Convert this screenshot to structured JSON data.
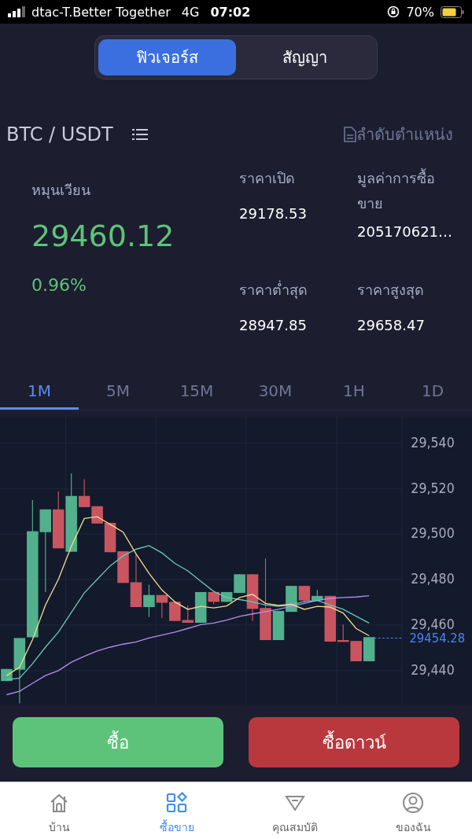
{
  "status_bar": {
    "carrier": "dtac-T.Better Together",
    "network": "4G",
    "time": "07:02",
    "battery": "70%"
  },
  "mode_tabs": [
    {
      "label": "ฟิวเจอร์ส",
      "selected": true
    },
    {
      "label": "สัญญา",
      "selected": false
    }
  ],
  "pair": {
    "symbol": "BTC / USDT",
    "positions_link": "ลำดับตำแหน่ง"
  },
  "turnover": {
    "label": "หมุนเวียน",
    "price": "29460.12",
    "change": "0.96%"
  },
  "stats": [
    {
      "label": "ราคาเปิด",
      "value": "29178.53"
    },
    {
      "label": "มูลค่าการซื้อขาย",
      "value": "205170621…"
    },
    {
      "label": "ราคาต่ำสุด",
      "value": "28947.85"
    },
    {
      "label": "ราคาสูงสุด",
      "value": "29658.47"
    }
  ],
  "intervals": [
    {
      "label": "1M",
      "selected": true
    },
    {
      "label": "5M",
      "selected": false
    },
    {
      "label": "15M",
      "selected": false
    },
    {
      "label": "30M",
      "selected": false
    },
    {
      "label": "1H",
      "selected": false
    },
    {
      "label": "1D",
      "selected": false
    }
  ],
  "chart": {
    "last_price": "29454.28",
    "chart_data": {
      "type": "candlestick",
      "grid": true,
      "ylim": [
        29423.7,
        29551.5
      ],
      "yticks": [
        {
          "value": 29540,
          "label": "29,540"
        },
        {
          "value": 29520,
          "label": "29,520"
        },
        {
          "value": 29500,
          "label": "29,500"
        },
        {
          "value": 29480,
          "label": "29,480"
        },
        {
          "value": 29460,
          "label": "29,460"
        },
        {
          "value": 29440,
          "label": "29,440"
        }
      ],
      "ohlc": [
        [
          29435.4,
          29440.7,
          29435.4,
          29440.7
        ],
        [
          29440.4,
          29454.3,
          29425.6,
          29454.3
        ],
        [
          29454.6,
          29514.9,
          29454.6,
          29501.2
        ],
        [
          29500.8,
          29510.8,
          29474.5,
          29510.8
        ],
        [
          29510.8,
          29518.7,
          29493.7,
          29493.7
        ],
        [
          29492.2,
          29526.6,
          29492.2,
          29516.7
        ],
        [
          29516.7,
          29524.0,
          29511.8,
          29511.8
        ],
        [
          29512.2,
          29512.2,
          29504.6,
          29504.6
        ],
        [
          29504.9,
          29504.9,
          29492.0,
          29492.0
        ],
        [
          29492.4,
          29492.4,
          29478.5,
          29478.5
        ],
        [
          29478.8,
          29491.3,
          29467.9,
          29467.9
        ],
        [
          29467.9,
          29477.7,
          29463.5,
          29473.2
        ],
        [
          29473.2,
          29473.2,
          29463.1,
          29469.8
        ],
        [
          29470.2,
          29470.2,
          29461.8,
          29461.8
        ],
        [
          29462.2,
          29468.6,
          29461.0,
          29461.0
        ],
        [
          29461.0,
          29474.5,
          29461.0,
          29474.5
        ],
        [
          29474.5,
          29474.5,
          29469.2,
          29470.2
        ],
        [
          29470.2,
          29474.5,
          29470.2,
          29474.5
        ],
        [
          29474.1,
          29482.3,
          29474.1,
          29482.3
        ],
        [
          29482.3,
          29482.3,
          29461.8,
          29467.1
        ],
        [
          29467.5,
          29489.3,
          29453.4,
          29453.4
        ],
        [
          29453.4,
          29466.2,
          29453.4,
          29466.2
        ],
        [
          29465.8,
          29477.2,
          29465.8,
          29477.2
        ],
        [
          29477.2,
          29477.2,
          29469.8,
          29470.8
        ],
        [
          29470.8,
          29475.4,
          29470.8,
          29472.8
        ],
        [
          29472.8,
          29472.8,
          29452.7,
          29452.7
        ],
        [
          29453.4,
          29460.2,
          29452.6,
          29452.6
        ],
        [
          29453.0,
          29453.0,
          29444.1,
          29444.1
        ],
        [
          29444.1,
          29454.7,
          29444.1,
          29454.7
        ]
      ],
      "series": [
        {
          "type": "line",
          "color": "#b58cf0",
          "values": [
            29429.4,
            29430.9,
            29434.4,
            29437.8,
            29440.0,
            29443.7,
            29446.3,
            29448.6,
            29450.3,
            29451.6,
            29452.6,
            29454.3,
            29455.6,
            29456.9,
            29458.5,
            29460.2,
            29460.9,
            29462.2,
            29463.8,
            29464.9,
            29465.9,
            29466.9,
            29468.2,
            29469.5,
            29470.8,
            29471.7,
            29472.1,
            29472.3,
            29472.9
          ]
        },
        {
          "type": "line",
          "color": "#6cc6b4",
          "values": [
            29436.0,
            29436.7,
            29443.0,
            29450.3,
            29456.9,
            29465.5,
            29474.1,
            29480.1,
            29486.0,
            29490.4,
            29493.3,
            29494.9,
            29491.7,
            29487.1,
            29483.8,
            29479.2,
            29474.8,
            29472.1,
            29471.2,
            29470.2,
            29468.8,
            29468.2,
            29468.8,
            29470.4,
            29470.8,
            29468.8,
            29466.9,
            29463.9,
            29460.9
          ]
        },
        {
          "type": "line",
          "color": "#f0d98c",
          "values": [
            29437.8,
            29441.5,
            29453.6,
            29468.8,
            29480.1,
            29494.6,
            29506.8,
            29507.6,
            29504.2,
            29500.8,
            29491.3,
            29482.7,
            29475.4,
            29470.2,
            29466.9,
            29468.2,
            29467.5,
            29468.4,
            29472.1,
            29473.5,
            29469.5,
            29468.6,
            29469.1,
            29466.9,
            29468.2,
            29467.9,
            29465.3,
            29458.5,
            29455.3
          ]
        }
      ]
    }
  },
  "actions": [
    {
      "label": "ซื้อ",
      "kind": "buy"
    },
    {
      "label": "ซื้อดาวน์",
      "kind": "sell"
    }
  ],
  "nav": [
    {
      "label": "บ้าน",
      "selected": false
    },
    {
      "label": "ซื้อขาย",
      "selected": true
    },
    {
      "label": "คุณสมบัติ",
      "selected": false
    },
    {
      "label": "ของฉัน",
      "selected": false
    }
  ]
}
